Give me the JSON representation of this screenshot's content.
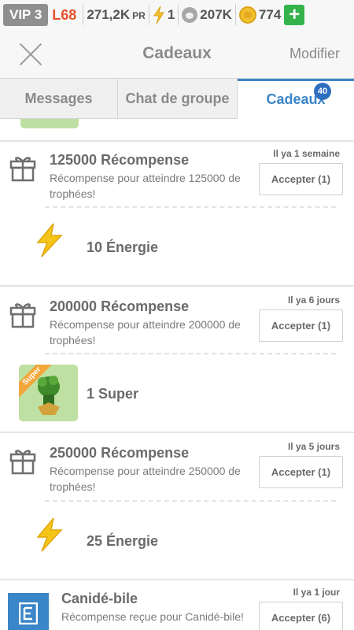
{
  "status": {
    "vip": "VIP 3",
    "level": "L68",
    "power": "271,2K",
    "power_unit": "PR",
    "energy": "1",
    "paw": "207K",
    "coins": "774",
    "plus": "+"
  },
  "nav": {
    "close_icon": "close-icon",
    "title": "Cadeaux",
    "action": "Modifier"
  },
  "tabs": [
    {
      "label": "Messages"
    },
    {
      "label": "Chat de groupe"
    },
    {
      "label": "Cadeaux",
      "badge": "40"
    }
  ],
  "colors": {
    "accent": "#3a86c8",
    "energy": "#f2c12e",
    "add": "#34b24b",
    "level": "#e8512a"
  },
  "items": [
    {
      "title": "125000 Récompense",
      "time": "Il ya 1 semaine",
      "desc": "Récompense pour atteindre 125000 de trophées!",
      "button": "Accepter (1)",
      "reward": "10 Énergie",
      "reward_icon": "energy-bolt-icon"
    },
    {
      "title": "200000 Récompense",
      "time": "Il ya 6 jours",
      "desc": "Récompense pour atteindre 200000 de trophées!",
      "button": "Accepter (1)",
      "reward": "1 Super",
      "reward_icon": "super-card-icon",
      "badge": "Super"
    },
    {
      "title": "250000 Récompense",
      "time": "Il ya 5 jours",
      "desc": "Récompense pour atteindre 250000 de trophées!",
      "button": "Accepter (1)",
      "reward": "25 Énergie",
      "reward_icon": "energy-bolt-icon"
    },
    {
      "title": "Canidé-bile",
      "time": "Il ya 1 jour",
      "desc": "Récompense reçue pour Canidé-bile!",
      "button": "Accepter (6)"
    }
  ]
}
